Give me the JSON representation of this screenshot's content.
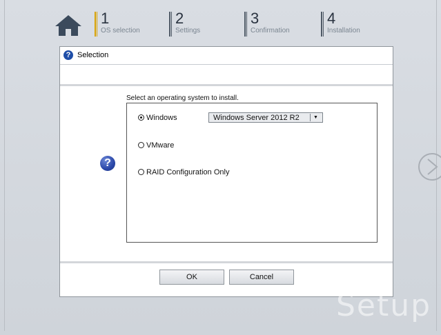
{
  "steps": [
    {
      "number": "1",
      "label": "OS selection"
    },
    {
      "number": "2",
      "label": "Settings"
    },
    {
      "number": "3",
      "label": "Confirmation"
    },
    {
      "number": "4",
      "label": "Installation"
    }
  ],
  "dialog": {
    "title": "Selection",
    "instruction": "Select an operating system to install.",
    "options": [
      {
        "label": "Windows",
        "selected": true
      },
      {
        "label": "VMware",
        "selected": false
      },
      {
        "label": "RAID Configuration Only",
        "selected": false
      }
    ],
    "os_select_value": "Windows Server 2012 R2",
    "ok_label": "OK",
    "cancel_label": "Cancel"
  },
  "watermark": "Setup",
  "icons": {
    "home": "home-icon",
    "help": "help-icon",
    "next": "next-arrow-icon",
    "dropdown": "dropdown-arrow-icon"
  },
  "colors": {
    "active_step": "#d8a100",
    "help_blue": "#2a47a8"
  }
}
